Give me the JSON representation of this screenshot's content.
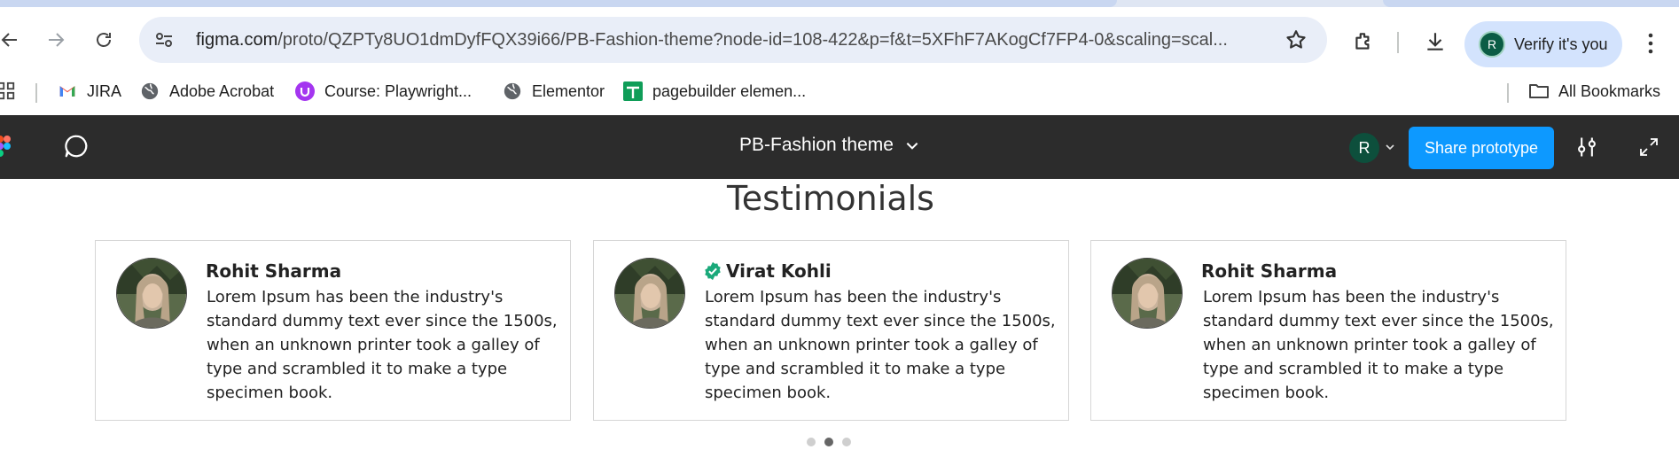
{
  "browser": {
    "url_domain": "figma.com",
    "url_path": "/proto/QZPTy8UO1dmDyfFQX39i66/PB-Fashion-theme?node-id=108-422&p=f&t=5XFhF7AKogCf7FP4-0&scaling=scal...",
    "verify_label": "Verify it's you",
    "profile_initial": "R"
  },
  "bookmarks": {
    "items": [
      {
        "label": "JIRA",
        "icon": "gmail-icon"
      },
      {
        "label": "Adobe Acrobat",
        "icon": "globe-icon"
      },
      {
        "label": "Course: Playwright...",
        "icon": "udemy-icon"
      },
      {
        "label": "Elementor",
        "icon": "globe-icon"
      },
      {
        "label": "pagebuilder elemen...",
        "icon": "sheets-icon"
      }
    ],
    "all_label": "All Bookmarks"
  },
  "figma": {
    "file_title": "PB-Fashion theme",
    "avatar_initial": "R",
    "share_label": "Share prototype"
  },
  "section": {
    "title": "Testimonials"
  },
  "testimonials": [
    {
      "name": "Rohit Sharma",
      "verified": false,
      "text": "Lorem Ipsum has been the industry's standard dummy text ever since the 1500s, when an unknown printer took a galley of type and scrambled it to make a type specimen book."
    },
    {
      "name": "Virat Kohli",
      "verified": true,
      "text": "Lorem Ipsum has been the industry's standard dummy text ever since the 1500s, when an unknown printer took a galley of type and scrambled it to make a type specimen book."
    },
    {
      "name": "Rohit Sharma",
      "verified": false,
      "text": "Lorem Ipsum has been the industry's standard dummy text ever since the 1500s, when an unknown printer took a galley of type and scrambled it to make a type specimen book."
    }
  ],
  "pagination": {
    "count": 3,
    "active": 1
  },
  "colors": {
    "figma_bar": "#2c2c2c",
    "share_button": "#0d99ff",
    "verified_badge": "#1aa97a"
  }
}
